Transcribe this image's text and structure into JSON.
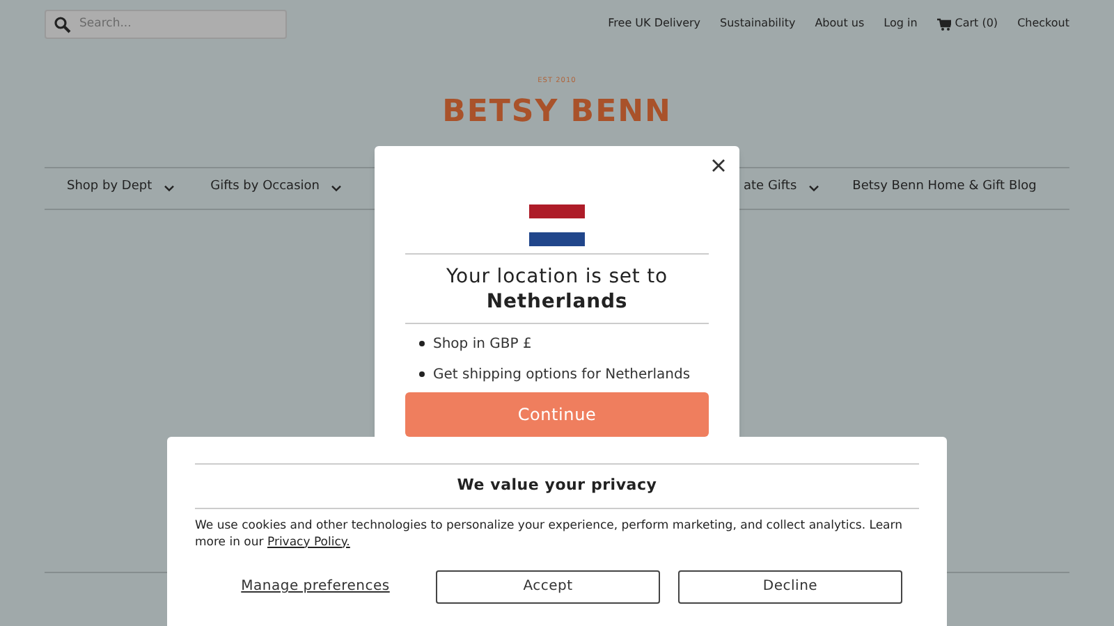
{
  "search": {
    "placeholder": "Search..."
  },
  "top_links": [
    {
      "label": "Free UK Delivery",
      "kind": "link"
    },
    {
      "label": "Sustainability",
      "kind": "link"
    },
    {
      "label": "About us",
      "kind": "link"
    },
    {
      "label": "Log in",
      "kind": "link"
    },
    {
      "label": "Cart (0)",
      "kind": "cart"
    },
    {
      "label": "Checkout",
      "kind": "link"
    }
  ],
  "logo": {
    "tagline": "EST 2010",
    "name": "BETSY BENN"
  },
  "nav": [
    {
      "label": "Shop by Dept",
      "dropdown": true
    },
    {
      "label": "Gifts by Occasion",
      "dropdown": true
    },
    {
      "label": "ate Gifts",
      "dropdown": true
    },
    {
      "label": "Betsy Benn Home & Gift Blog",
      "dropdown": false
    }
  ],
  "location_modal": {
    "title": "Your location is set to",
    "country": "Netherlands",
    "bullets": [
      "Shop in GBP £",
      "Get shipping options for Netherlands"
    ],
    "button": "Continue"
  },
  "cookie_banner": {
    "title": "We value your privacy",
    "text": "We use cookies and other technologies to personalize your experience, perform marketing, and collect analytics. Learn more in our",
    "link": "Privacy Policy.",
    "manage": "Manage preferences",
    "buttons": [
      "Accept",
      "Decline"
    ]
  }
}
